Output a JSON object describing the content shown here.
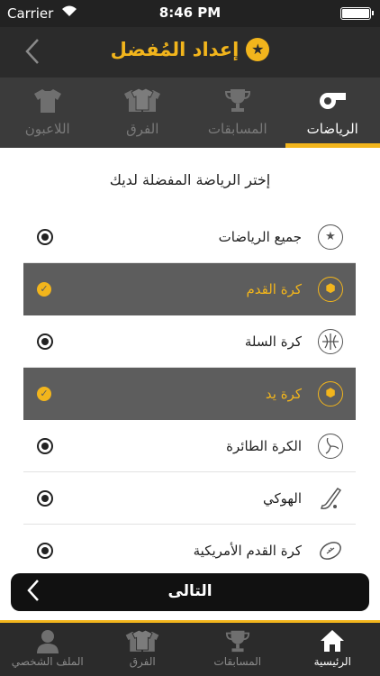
{
  "status_bar": {
    "carrier": "Carrier",
    "time": "8:46 PM"
  },
  "nav": {
    "title": "إعداد المُفضل"
  },
  "top_tabs": [
    {
      "label": "الرياضات",
      "icon": "whistle-icon",
      "active": true
    },
    {
      "label": "المسابقات",
      "icon": "trophy-icon",
      "active": false
    },
    {
      "label": "الفرق",
      "icon": "team-shirts-icon",
      "active": false
    },
    {
      "label": "اللاعبون",
      "icon": "shirt-icon",
      "active": false
    }
  ],
  "prompt": "إختر الرياضة المفضلة لديك",
  "sports": [
    {
      "label": "جميع الرياضات",
      "icon": "star-icon",
      "selected": false
    },
    {
      "label": "كرة القدم",
      "icon": "football-icon",
      "selected": true
    },
    {
      "label": "كرة السلة",
      "icon": "basketball-icon",
      "selected": false
    },
    {
      "label": "كرة يد",
      "icon": "handball-icon",
      "selected": true
    },
    {
      "label": "الكرة الطائرة",
      "icon": "volleyball-icon",
      "selected": false
    },
    {
      "label": "الهوكي",
      "icon": "hockey-icon",
      "selected": false
    },
    {
      "label": "كرة القدم الأمريكية",
      "icon": "american-football-icon",
      "selected": false
    }
  ],
  "next": {
    "label": "التالى"
  },
  "bottom_tabs": [
    {
      "label": "الرئيسية",
      "icon": "home-icon",
      "active": true
    },
    {
      "label": "المسابقات",
      "icon": "trophy-icon",
      "active": false
    },
    {
      "label": "الفرق",
      "icon": "team-shirts-icon",
      "active": false
    },
    {
      "label": "الملف الشخصي",
      "icon": "person-icon",
      "active": false
    }
  ],
  "colors": {
    "accent": "#f2b51c",
    "dark": "#2b2b2b",
    "selected_row": "#5d5d5d"
  }
}
